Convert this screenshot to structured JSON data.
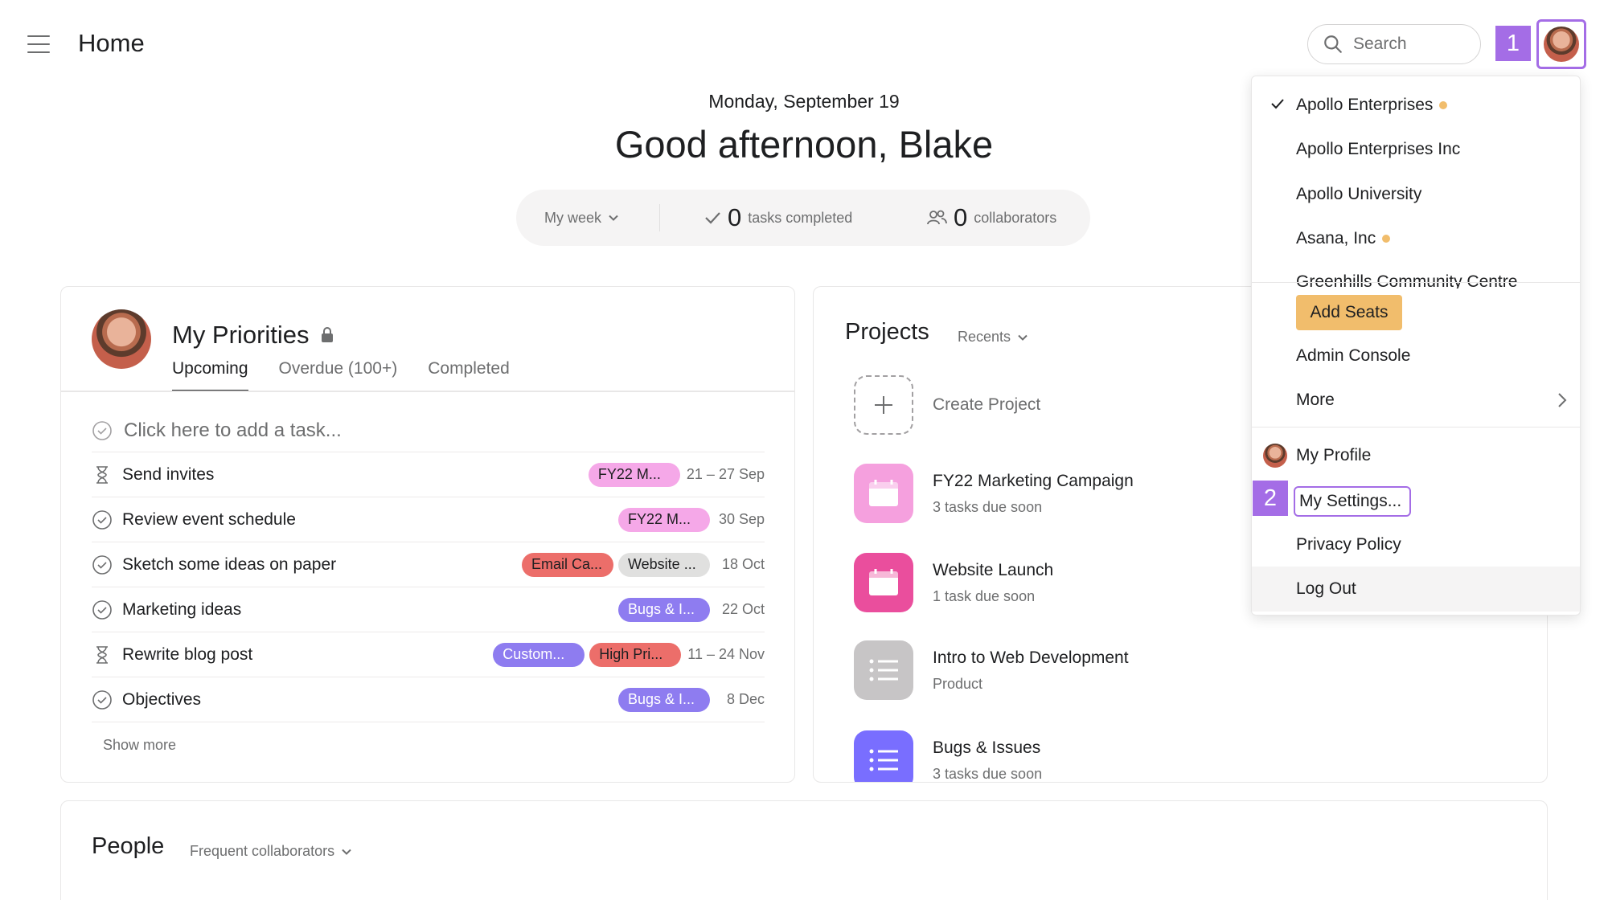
{
  "header": {
    "title": "Home",
    "search_placeholder": "Search",
    "step_badge_1": "1"
  },
  "greeting": {
    "date": "Monday, September 19",
    "message": "Good afternoon, Blake",
    "week_filter": "My week",
    "tasks_completed_count": "0",
    "tasks_completed_label": "tasks completed",
    "collaborators_count": "0",
    "collaborators_label": "collaborators"
  },
  "priorities": {
    "title": "My Priorities",
    "tabs": [
      {
        "label": "Upcoming",
        "active": true
      },
      {
        "label": "Overdue (100+)",
        "active": false
      },
      {
        "label": "Completed",
        "active": false
      }
    ],
    "add_task_placeholder": "Click here to add a task...",
    "tasks": [
      {
        "name": "Send invites",
        "icon": "hourglass-icon",
        "tags": [
          {
            "label": "FY22 M...",
            "color": "pink"
          }
        ],
        "due": "21 – 27 Sep"
      },
      {
        "name": "Review event schedule",
        "icon": "check-circle-icon",
        "tags": [
          {
            "label": "FY22 M...",
            "color": "pink"
          }
        ],
        "due": "30 Sep"
      },
      {
        "name": "Sketch some ideas on paper",
        "icon": "check-circle-icon",
        "tags": [
          {
            "label": "Email Ca...",
            "color": "red"
          },
          {
            "label": "Website ...",
            "color": "gray"
          }
        ],
        "due": "18 Oct"
      },
      {
        "name": "Marketing ideas",
        "icon": "check-circle-icon",
        "tags": [
          {
            "label": "Bugs & I...",
            "color": "purple"
          }
        ],
        "due": "22 Oct"
      },
      {
        "name": "Rewrite blog post",
        "icon": "hourglass-icon",
        "tags": [
          {
            "label": "Custom...",
            "color": "purple"
          },
          {
            "label": "High Pri...",
            "color": "red"
          }
        ],
        "due": "11 – 24 Nov"
      },
      {
        "name": "Objectives",
        "icon": "check-circle-icon",
        "tags": [
          {
            "label": "Bugs & I...",
            "color": "purple"
          }
        ],
        "due": "8 Dec"
      }
    ],
    "show_more": "Show more"
  },
  "projects": {
    "title": "Projects",
    "filter": "Recents",
    "create_label": "Create Project",
    "items": [
      {
        "name": "FY22 Marketing Campaign",
        "subtitle": "3 tasks due soon",
        "icon_color": "#f5a0de",
        "icon": "calendar-icon"
      },
      {
        "name": "Website Launch",
        "subtitle": "1 task due soon",
        "icon_color": "#ea4e9d",
        "icon": "calendar-icon"
      },
      {
        "name": "Intro to Web Development",
        "subtitle": "Product",
        "icon_color": "#c7c5c6",
        "icon": "list-icon"
      },
      {
        "name": "Bugs & Issues",
        "subtitle": "3 tasks due soon",
        "icon_color": "#796eff",
        "icon": "list-icon"
      }
    ]
  },
  "people": {
    "title": "People",
    "filter": "Frequent collaborators"
  },
  "menu": {
    "workspaces": [
      {
        "label": "Apollo Enterprises",
        "checked": true,
        "dot": true
      },
      {
        "label": "Apollo Enterprises Inc",
        "checked": false,
        "dot": false
      },
      {
        "label": "Apollo University",
        "checked": false,
        "dot": false
      },
      {
        "label": "Asana, Inc",
        "checked": false,
        "dot": true
      },
      {
        "label": "Greenhills Community Centre",
        "checked": false,
        "dot": false
      }
    ],
    "add_seats": "Add Seats",
    "admin_console": "Admin Console",
    "more": "More",
    "my_profile": "My Profile",
    "my_settings": "My Settings...",
    "privacy_policy": "Privacy Policy",
    "log_out": "Log Out",
    "step_badge_2": "2"
  },
  "colors": {
    "accent": "#a46de6",
    "add_seats": "#f1bd6c",
    "workspace_dot": "#f1bd6c"
  }
}
